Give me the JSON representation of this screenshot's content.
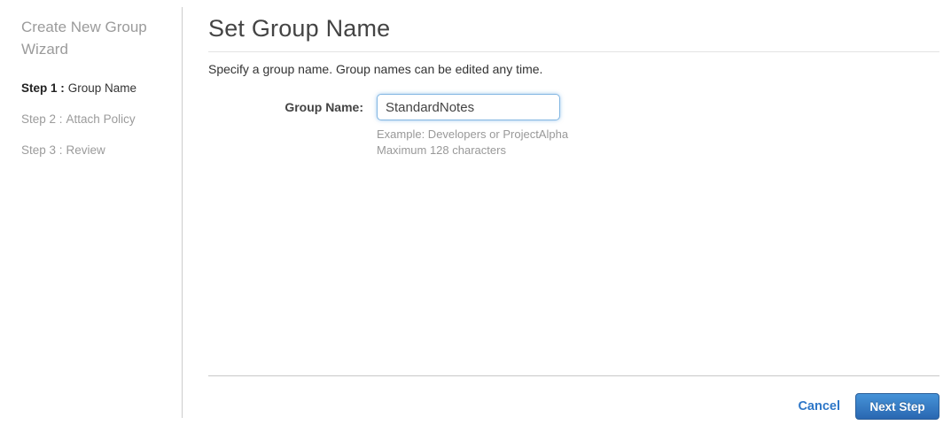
{
  "sidebar": {
    "title": "Create New Group Wizard",
    "steps": [
      {
        "prefix": "Step 1 :",
        "label": "Group Name"
      },
      {
        "prefix": "Step 2 :",
        "label": "Attach Policy"
      },
      {
        "prefix": "Step 3 :",
        "label": "Review"
      }
    ]
  },
  "main": {
    "title": "Set Group Name",
    "description": "Specify a group name. Group names can be edited any time.",
    "form": {
      "group_name_label": "Group Name:",
      "group_name_value": "StandardNotes",
      "hint_line1": "Example: Developers or ProjectAlpha",
      "hint_line2": "Maximum 128 characters"
    },
    "footer": {
      "cancel_label": "Cancel",
      "next_label": "Next Step"
    }
  },
  "colors": {
    "accent_blue": "#2e77c8",
    "button_gradient_top": "#4693d8",
    "button_gradient_bottom": "#2a67b1",
    "muted_text": "#9b9b9b"
  }
}
